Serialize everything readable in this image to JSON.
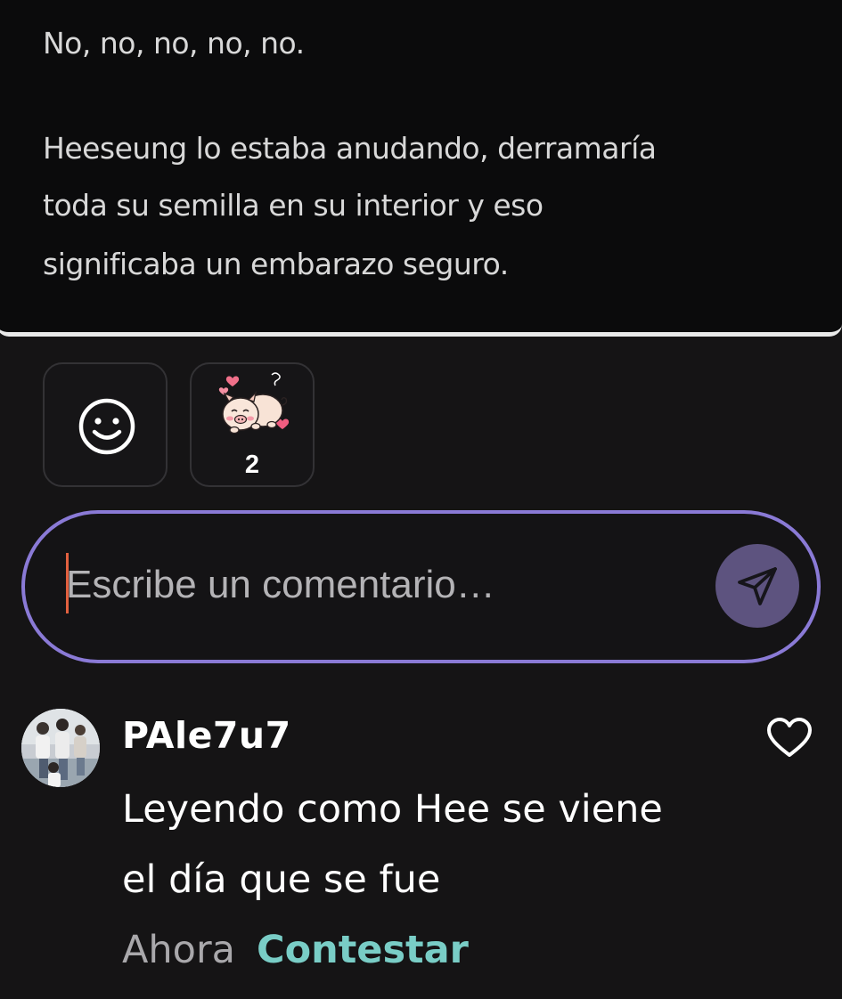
{
  "excerpt": {
    "lines": [
      "No, no, no, no, no.",
      "Heeseung lo estaba anudando, derramaría",
      "toda su semilla en su interior  y eso",
      "significaba un embarazo seguro."
    ]
  },
  "reactions": {
    "add_icon": "smiley-icon",
    "items": [
      {
        "icon": "pig-sticker-icon",
        "count": "2"
      }
    ]
  },
  "comment_input": {
    "placeholder": "Escribe un comentario…",
    "value": "",
    "send_icon": "send-icon",
    "accent_color": "#8a7ad6"
  },
  "comments": [
    {
      "username": "PAle7u7",
      "text_lines": [
        "Leyendo como Hee  se viene",
        "el día que se fue"
      ],
      "timestamp": "Ahora",
      "reply_label": "Contestar",
      "like_icon": "heart-icon"
    }
  ],
  "colors": {
    "background": "#151415",
    "reply_link": "#79cdc6",
    "send_button": "#5d537f"
  }
}
